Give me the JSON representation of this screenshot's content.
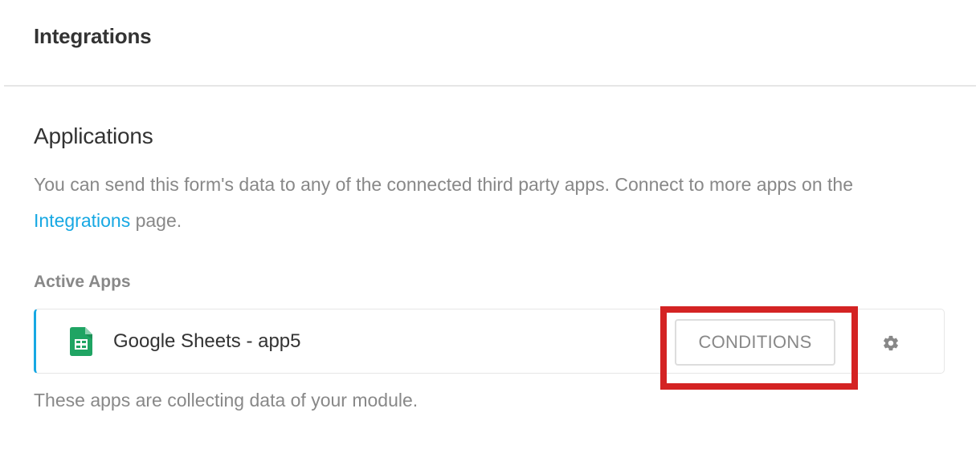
{
  "header": {
    "title": "Integrations"
  },
  "applications": {
    "title": "Applications",
    "description_prefix": "You can send this form's data to any of the connected third party apps. Connect to more apps on the ",
    "description_link": "Integrations",
    "description_suffix": " page.",
    "active_apps_label": "Active Apps",
    "apps": [
      {
        "name": "Google Sheets - app5",
        "icon": "google-sheets-icon",
        "conditions_label": "CONDITIONS",
        "settings_icon": "gear-icon"
      }
    ],
    "footer_note": "These apps are collecting data of your module."
  },
  "colors": {
    "accent": "#17a8e3",
    "highlight": "#d42323",
    "sheets_green": "#1fa463"
  }
}
